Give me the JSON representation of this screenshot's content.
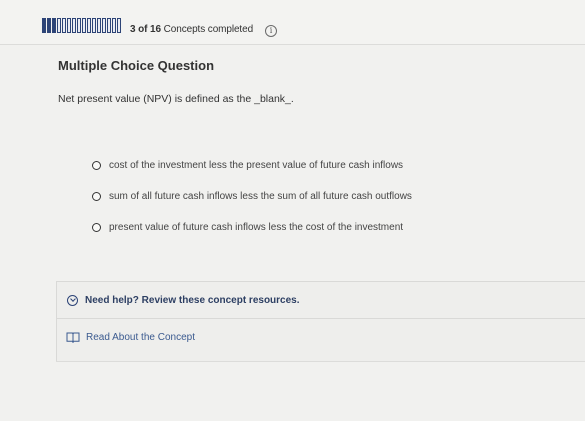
{
  "progress": {
    "completed": 3,
    "total": 16,
    "count_text": "3 of 16",
    "label": "Concepts completed"
  },
  "icons": {
    "info": "info-icon",
    "expand": "chevron-down-circle-icon",
    "book": "book-icon"
  },
  "question": {
    "type": "Multiple Choice Question",
    "prompt": "Net present value (NPV) is defined as the _blank_."
  },
  "options": [
    {
      "label": "cost of the investment less the present value of future cash inflows"
    },
    {
      "label": "sum of all future cash inflows less the sum of all future cash outflows"
    },
    {
      "label": "present value of future cash inflows less the cost of the investment"
    }
  ],
  "help": {
    "toggle_label": "Need help? Review these concept resources.",
    "read_label": "Read About the Concept"
  },
  "colors": {
    "accent": "#2d4477",
    "link": "#3b5a8f",
    "background": "#f1f1ef"
  }
}
